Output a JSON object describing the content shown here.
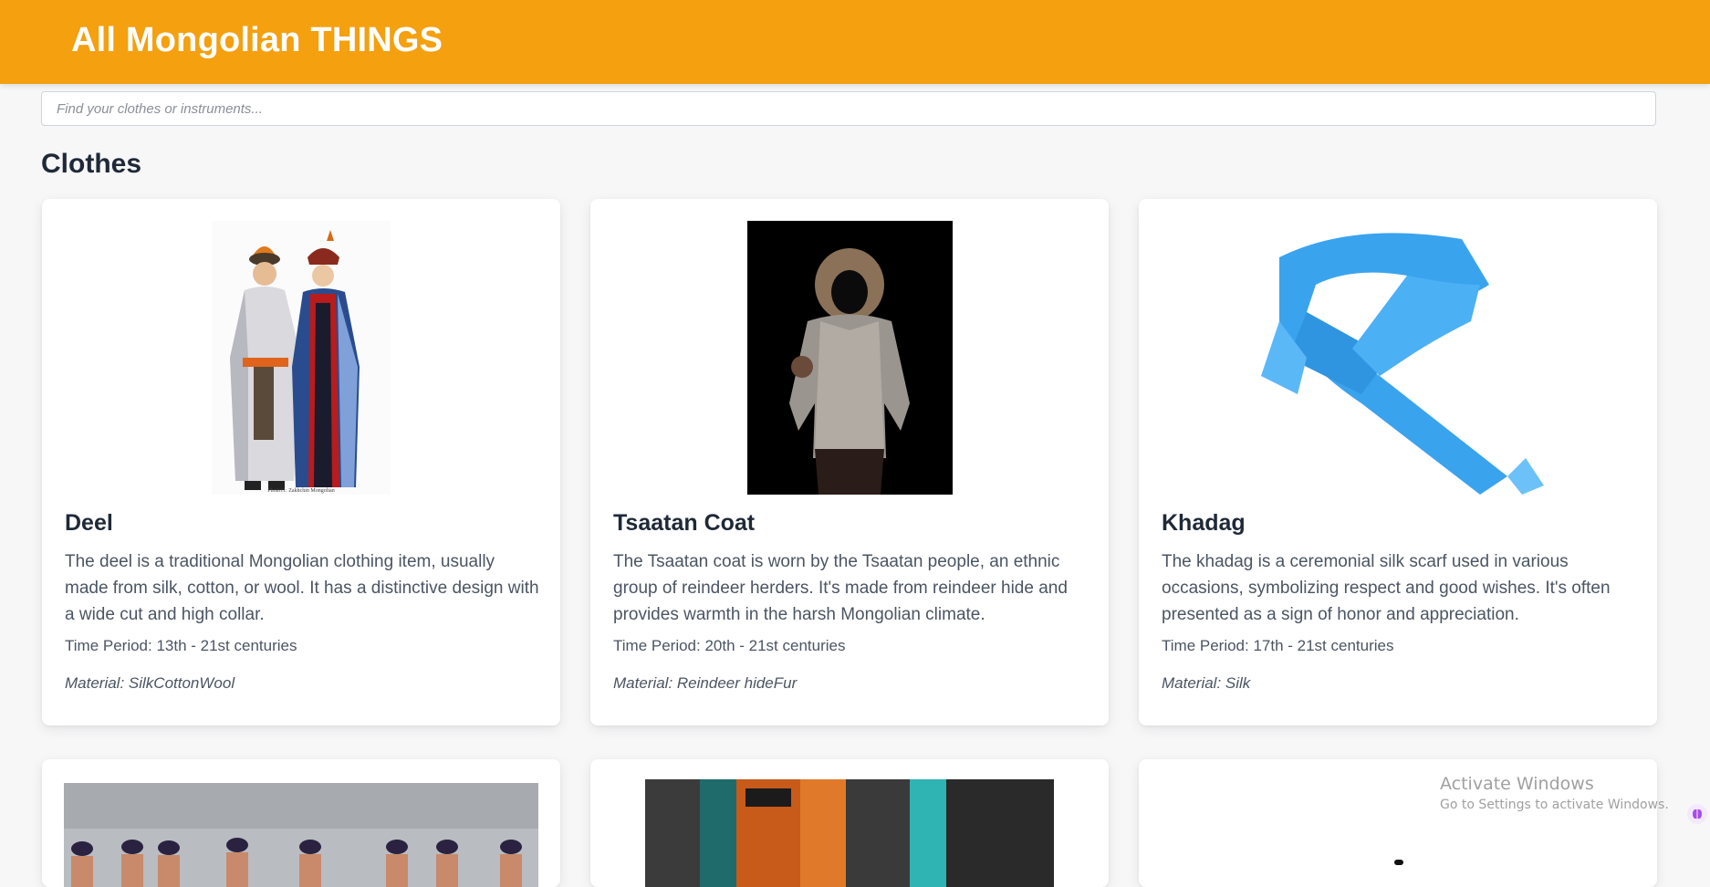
{
  "header": {
    "title": "All Mongolian THINGS"
  },
  "search": {
    "placeholder": "Find your clothes or instruments...",
    "value": ""
  },
  "section": {
    "title": "Clothes"
  },
  "cards": [
    {
      "name": "Deel",
      "description": "The deel is a traditional Mongolian clothing item, usually made from silk, cotton, or wool. It has a distinctive design with a wide cut and high collar.",
      "time_period": "Time Period: 13th - 21st centuries",
      "material": "Material: SilkCottonWool",
      "image_caption": "Photo11: Zakhchin Mongolian"
    },
    {
      "name": "Tsaatan Coat",
      "description": "The Tsaatan coat is worn by the Tsaatan people, an ethnic group of reindeer herders. It's made from reindeer hide and provides warmth in the harsh Mongolian climate.",
      "time_period": "Time Period: 20th - 21st centuries",
      "material": "Material: Reindeer hideFur"
    },
    {
      "name": "Khadag",
      "description": "The khadag is a ceremonial silk scarf used in various occasions, symbolizing respect and good wishes. It's often presented as a sign of honor and appreciation.",
      "time_period": "Time Period: 17th - 21st centuries",
      "material": "Material: Silk"
    }
  ],
  "watermark": {
    "line1": "Activate Windows",
    "line2": "Go to Settings to activate Windows."
  },
  "colors": {
    "header_bg": "#f4a00f",
    "khadag_blue": "#3aa3ee"
  }
}
